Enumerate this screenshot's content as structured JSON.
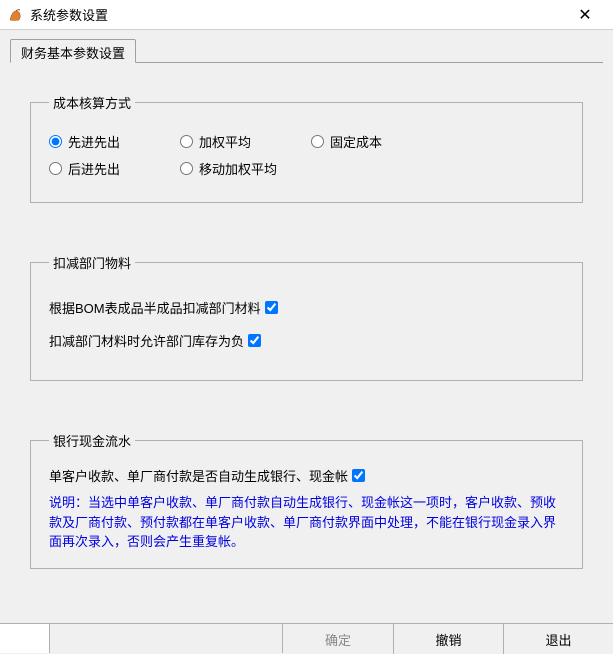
{
  "window": {
    "title": "系统参数设置"
  },
  "tab": {
    "label": "财务基本参数设置"
  },
  "group_cost": {
    "legend": "成本核算方式",
    "options": {
      "fifo": "先进先出",
      "weighted": "加权平均",
      "fixed": "固定成本",
      "lifo": "后进先出",
      "moving": "移动加权平均"
    }
  },
  "group_deduct": {
    "legend": "扣减部门物料",
    "check1": "根据BOM表成品半成品扣减部门材料",
    "check2": "扣减部门材料时允许部门库存为负"
  },
  "group_bank": {
    "legend": "银行现金流水",
    "check1": "单客户收款、单厂商付款是否自动生成银行、现金帐",
    "note": "说明：当选中单客户收款、单厂商付款自动生成银行、现金帐这一项时，客户收款、预收款及厂商付款、预付款都在单客户收款、单厂商付款界面中处理，不能在银行现金录入界面再次录入，否则会产生重复帐。"
  },
  "buttons": {
    "ok": "确定",
    "cancel": "撤销",
    "exit": "退出"
  }
}
